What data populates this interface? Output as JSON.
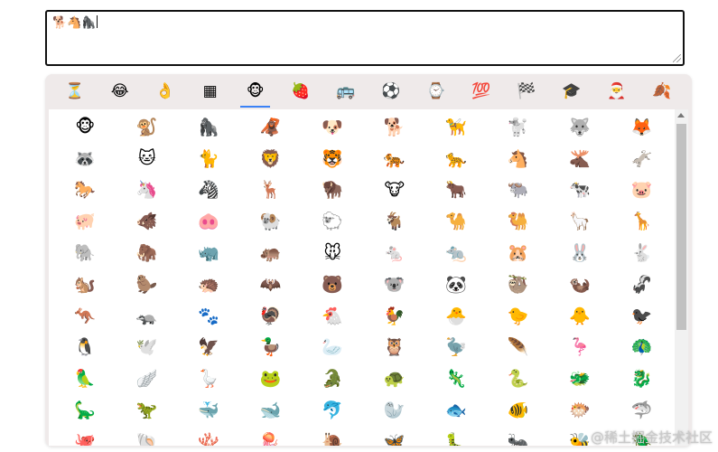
{
  "textarea": {
    "value": "🐕🐴🦍"
  },
  "categories": [
    {
      "icon": "⏳",
      "name": "recent"
    },
    {
      "icon": "😂",
      "name": "smileys"
    },
    {
      "icon": "👌",
      "name": "people"
    },
    {
      "icon": "▦",
      "name": "symbols-grid"
    },
    {
      "icon": "🐵",
      "name": "animals"
    },
    {
      "icon": "🍓",
      "name": "food"
    },
    {
      "icon": "🚌",
      "name": "travel"
    },
    {
      "icon": "⚽",
      "name": "activities"
    },
    {
      "icon": "⌚",
      "name": "objects"
    },
    {
      "icon": "💯",
      "name": "symbols"
    },
    {
      "icon": "🏁",
      "name": "flags"
    },
    {
      "icon": "🎓",
      "name": "education"
    },
    {
      "icon": "🎅",
      "name": "seasonal"
    },
    {
      "icon": "🍂",
      "name": "nature"
    }
  ],
  "active_category": 4,
  "emojis": [
    "🐵",
    "🐒",
    "🦍",
    "🦧",
    "🐶",
    "🐕",
    "🦮",
    "🐩",
    "🐺",
    "🦊",
    "🦝",
    "🐱",
    "🐈",
    "🦁",
    "🐯",
    "🐅",
    "🐆",
    "🐴",
    "🫎",
    "🫏",
    "🐎",
    "🦄",
    "🦓",
    "🦌",
    "🦬",
    "🐮",
    "🐂",
    "🐃",
    "🐄",
    "🐷",
    "🐖",
    "🐗",
    "🐽",
    "🐏",
    "🐑",
    "🐐",
    "🐪",
    "🐫",
    "🦙",
    "🦒",
    "🐘",
    "🦣",
    "🦏",
    "🦛",
    "🐭",
    "🐁",
    "🐀",
    "🐹",
    "🐰",
    "🐇",
    "🐿️",
    "🦫",
    "🦔",
    "🦇",
    "🐻",
    "🐨",
    "🐼",
    "🦥",
    "🦦",
    "🦨",
    "🦘",
    "🦡",
    "🐾",
    "🦃",
    "🐔",
    "🐓",
    "🐣",
    "🐤",
    "🐥",
    "🐦‍⬛",
    "🐧",
    "🕊️",
    "🦅",
    "🦆",
    "🦢",
    "🦉",
    "🦤",
    "🪶",
    "🦩",
    "🦚",
    "🦜",
    "🪽",
    "🪿",
    "🐸",
    "🐊",
    "🐢",
    "🦎",
    "🐍",
    "🐲",
    "🐉",
    "🦕",
    "🦖",
    "🐳",
    "🐋",
    "🐬",
    "🦭",
    "🐟",
    "🐠",
    "🐡",
    "🦈",
    "🐙",
    "🐚",
    "🪸",
    "🪼",
    "🐌",
    "🦋",
    "🐛",
    "🐜",
    "🐝",
    "🪲"
  ],
  "watermark": "@稀土掘金技术社区"
}
